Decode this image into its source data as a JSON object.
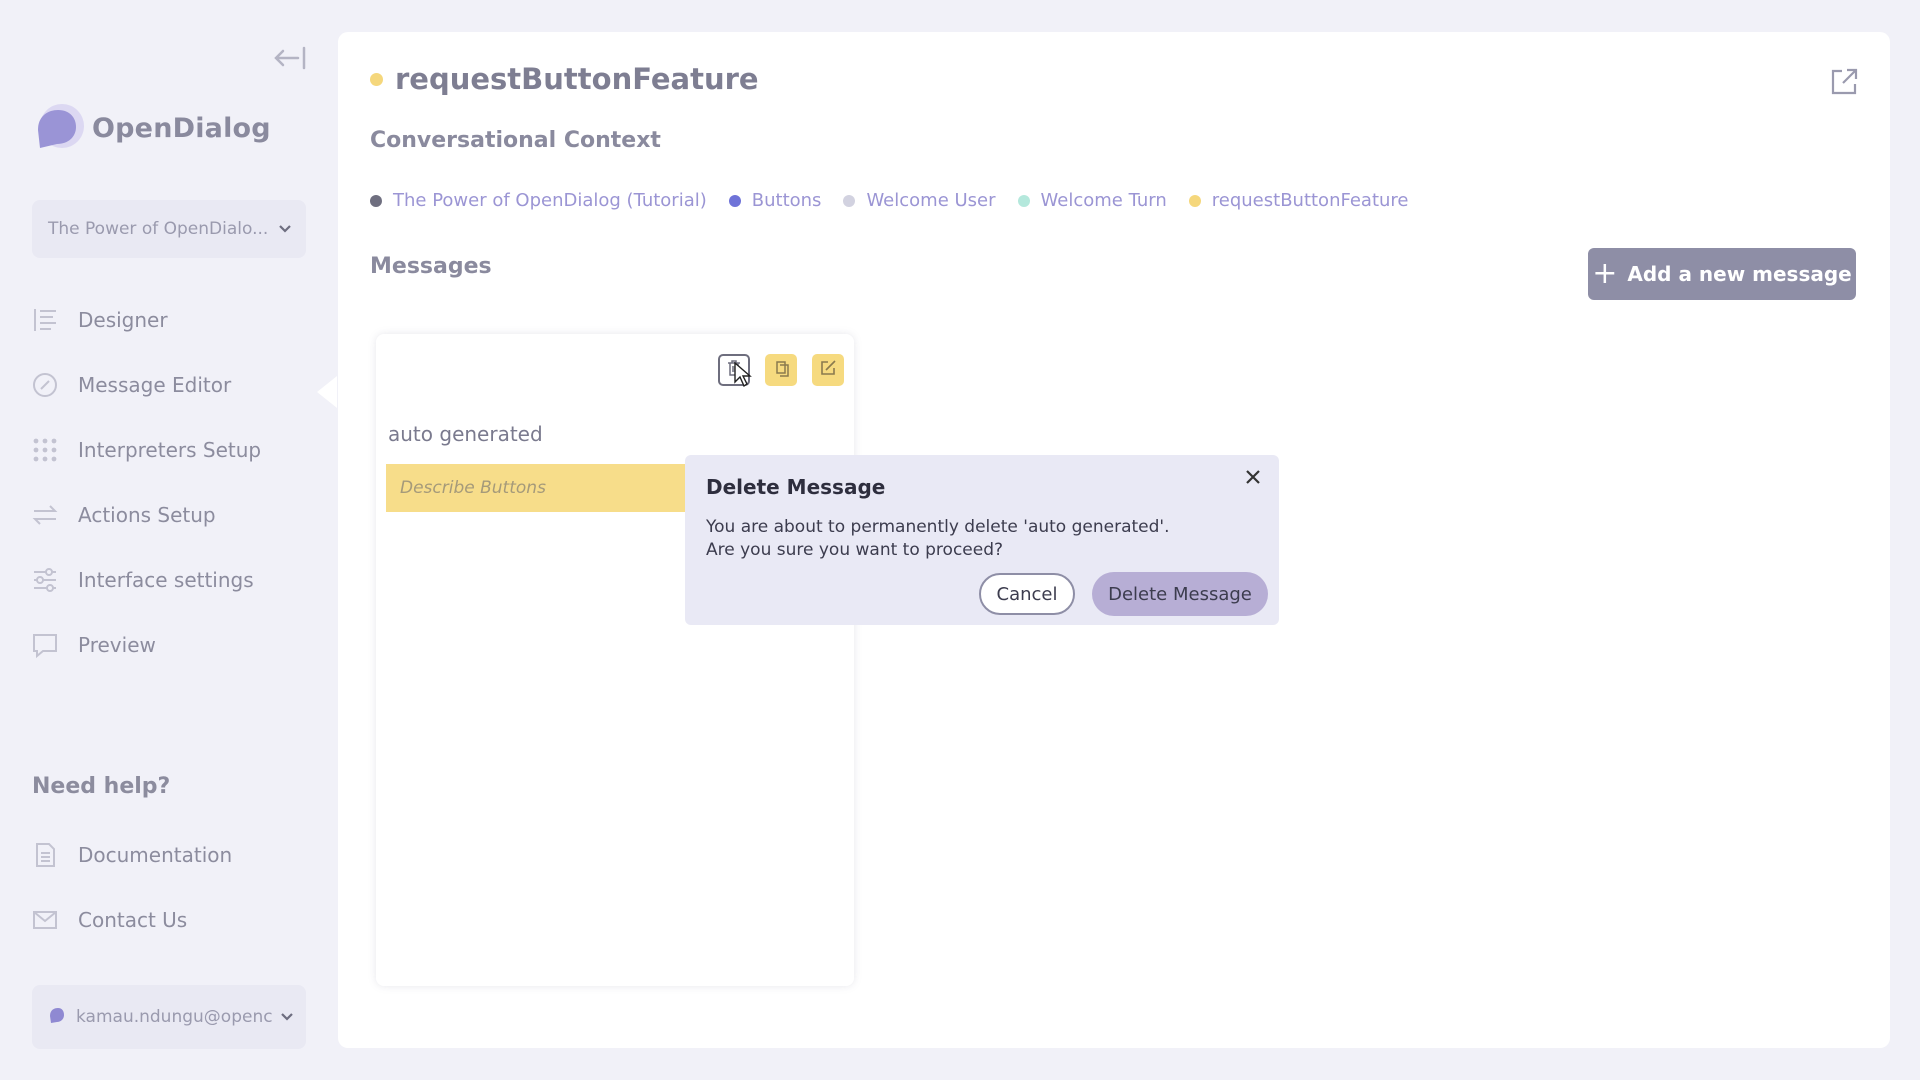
{
  "sidebar": {
    "logo_text": "OpenDialog",
    "scenario_select": "The Power of OpenDialo...",
    "nav": [
      {
        "label": "Designer",
        "icon": "designer-icon"
      },
      {
        "label": "Message Editor",
        "icon": "message-editor-icon"
      },
      {
        "label": "Interpreters Setup",
        "icon": "interpreters-icon"
      },
      {
        "label": "Actions Setup",
        "icon": "actions-icon"
      },
      {
        "label": "Interface settings",
        "icon": "sliders-icon"
      },
      {
        "label": "Preview",
        "icon": "preview-icon"
      }
    ],
    "help_title": "Need help?",
    "help_nav": [
      {
        "label": "Documentation",
        "icon": "document-icon"
      },
      {
        "label": "Contact Us",
        "icon": "mail-icon"
      }
    ],
    "user": "kamau.ndungu@openc"
  },
  "main": {
    "intent_title": "requestButtonFeature",
    "context_heading": "Conversational Context",
    "breadcrumb": [
      {
        "label": "The Power of OpenDialog (Tutorial)",
        "color": "#6f6f80"
      },
      {
        "label": "Buttons",
        "color": "#6f73d8"
      },
      {
        "label": "Welcome User",
        "color": "#d2d2e0"
      },
      {
        "label": "Welcome Turn",
        "color": "#b4e8dc"
      },
      {
        "label": "requestButtonFeature",
        "color": "#f5d77c"
      }
    ],
    "messages_heading": "Messages",
    "add_button": "Add a new message"
  },
  "card": {
    "name": "auto generated",
    "bubble_text": "Describe Buttons"
  },
  "dialog": {
    "title": "Delete Message",
    "line1": "You are about to permanently delete 'auto generated'.",
    "line2": "Are you sure you want to proceed?",
    "cancel": "Cancel",
    "confirm": "Delete Message"
  },
  "colors": {
    "accent": "#8e8ea6",
    "yellow": "#f6da7f",
    "confirm": "#b7aed5"
  }
}
